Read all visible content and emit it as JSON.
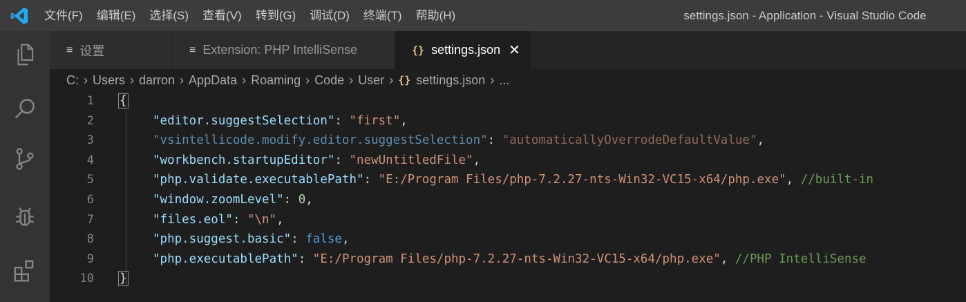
{
  "window": {
    "title": "settings.json - Application - Visual Studio Code"
  },
  "menu": [
    "文件(F)",
    "编辑(E)",
    "选择(S)",
    "查看(V)",
    "转到(G)",
    "调试(D)",
    "终端(T)",
    "帮助(H)"
  ],
  "activity_bar": [
    "explorer-icon",
    "search-icon",
    "source-control-icon",
    "debug-icon",
    "extensions-icon"
  ],
  "tabs": [
    {
      "icon": "≡",
      "label": "设置"
    },
    {
      "icon": "≡",
      "label": "Extension: PHP IntelliSense"
    },
    {
      "icon": "{}",
      "label": "settings.json",
      "close": "✕"
    }
  ],
  "breadcrumb": {
    "parts": [
      "C:",
      "Users",
      "darron",
      "AppData",
      "Roaming",
      "Code",
      "User"
    ],
    "file_icon": "{}",
    "file": "settings.json",
    "more": "..."
  },
  "editor": {
    "line_numbers": [
      "1",
      "2",
      "3",
      "4",
      "5",
      "6",
      "7",
      "8",
      "9",
      "10"
    ],
    "lines": [
      {
        "tokens": [
          {
            "t": "{",
            "c": "p brace-box"
          }
        ]
      },
      {
        "tokens": [
          {
            "t": "\"editor.suggestSelection\"",
            "c": "k"
          },
          {
            "t": ": ",
            "c": "p"
          },
          {
            "t": "\"first\"",
            "c": "s"
          },
          {
            "t": ",",
            "c": "p"
          }
        ]
      },
      {
        "tokens": [
          {
            "t": "\"vsintellicode.modify.editor.suggestSelection\"",
            "c": "k-dim"
          },
          {
            "t": ": ",
            "c": "p"
          },
          {
            "t": "\"automaticallyOverrodeDefaultValue\"",
            "c": "s-dim"
          },
          {
            "t": ",",
            "c": "p"
          }
        ]
      },
      {
        "tokens": [
          {
            "t": "\"workbench.startupEditor\"",
            "c": "k"
          },
          {
            "t": ": ",
            "c": "p"
          },
          {
            "t": "\"newUntitledFile\"",
            "c": "s"
          },
          {
            "t": ",",
            "c": "p"
          }
        ]
      },
      {
        "tokens": [
          {
            "t": "\"php.validate.executablePath\"",
            "c": "k"
          },
          {
            "t": ": ",
            "c": "p"
          },
          {
            "t": "\"E:/Program Files/php-7.2.27-nts-Win32-VC15-x64/php.exe\"",
            "c": "s"
          },
          {
            "t": ", ",
            "c": "p"
          },
          {
            "t": "//built-in",
            "c": "c"
          }
        ]
      },
      {
        "tokens": [
          {
            "t": "\"window.zoomLevel\"",
            "c": "k"
          },
          {
            "t": ": ",
            "c": "p"
          },
          {
            "t": "0",
            "c": "n"
          },
          {
            "t": ",",
            "c": "p"
          }
        ]
      },
      {
        "tokens": [
          {
            "t": "\"files.eol\"",
            "c": "k"
          },
          {
            "t": ": ",
            "c": "p"
          },
          {
            "t": "\"\\n\"",
            "c": "s"
          },
          {
            "t": ",",
            "c": "p"
          }
        ]
      },
      {
        "tokens": [
          {
            "t": "\"php.suggest.basic\"",
            "c": "k"
          },
          {
            "t": ": ",
            "c": "p"
          },
          {
            "t": "false",
            "c": "b"
          },
          {
            "t": ",",
            "c": "p"
          }
        ]
      },
      {
        "tokens": [
          {
            "t": "\"php.executablePath\"",
            "c": "k"
          },
          {
            "t": ": ",
            "c": "p"
          },
          {
            "t": "\"E:/Program Files/php-7.2.27-nts-Win32-VC15-x64/php.exe\"",
            "c": "s"
          },
          {
            "t": ", ",
            "c": "p"
          },
          {
            "t": "//PHP IntelliSense",
            "c": "c"
          }
        ]
      },
      {
        "tokens": [
          {
            "t": "}",
            "c": "p brace-box"
          }
        ]
      }
    ]
  }
}
